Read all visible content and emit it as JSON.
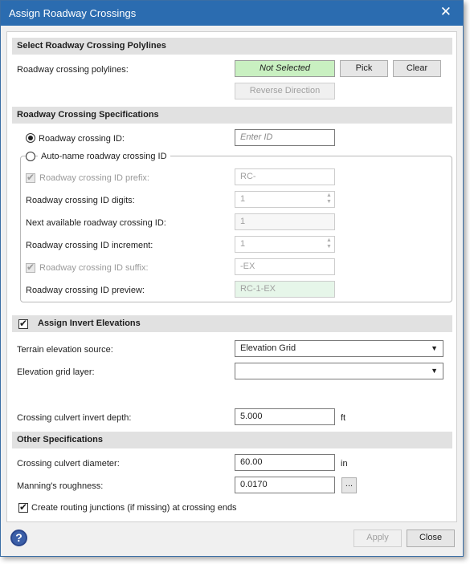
{
  "window": {
    "title": "Assign Roadway Crossings",
    "close_glyph": "✕"
  },
  "sections": {
    "polylines": "Select Roadway Crossing Polylines",
    "specifications": "Roadway Crossing Specifications",
    "invert": "Assign Invert Elevations",
    "other": "Other Specifications"
  },
  "polylines": {
    "label": "Roadway crossing polylines:",
    "status": "Not Selected",
    "status_color": "#c9f0c1",
    "pick_label": "Pick",
    "clear_label": "Clear",
    "reverse_label": "Reverse Direction"
  },
  "id_options": {
    "manual_label": "Roadway crossing ID:",
    "manual_placeholder": "Enter ID",
    "manual_selected": true,
    "auto_label": "Auto-name roadway crossing ID",
    "auto_selected": false
  },
  "auto": {
    "prefix_label": "Roadway crossing ID prefix:",
    "prefix_value": "RC-",
    "prefix_checked": true,
    "digits_label": "Roadway crossing ID digits:",
    "digits_value": "1",
    "next_label": "Next available roadway crossing ID:",
    "next_value": "1",
    "increment_label": "Roadway crossing ID increment:",
    "increment_value": "1",
    "suffix_label": "Roadway crossing ID suffix:",
    "suffix_value": "-EX",
    "suffix_checked": true,
    "preview_label": "Roadway crossing ID preview:",
    "preview_value": "RC-1-EX"
  },
  "invert": {
    "checked": true,
    "terrain_label": "Terrain elevation source:",
    "terrain_value": "Elevation Grid",
    "grid_label": "Elevation grid layer:",
    "grid_value": "",
    "depth_label": "Crossing culvert invert depth:",
    "depth_value": "5.000",
    "depth_unit": "ft"
  },
  "other": {
    "diameter_label": "Crossing culvert diameter:",
    "diameter_value": "60.00",
    "diameter_unit": "in",
    "manning_label": "Manning's roughness:",
    "manning_value": "0.0170",
    "browse_label": "...",
    "routing_label": "Create routing junctions (if missing) at crossing ends",
    "routing_checked": true
  },
  "footer": {
    "help_glyph": "?",
    "apply_label": "Apply",
    "close_label": "Close"
  }
}
